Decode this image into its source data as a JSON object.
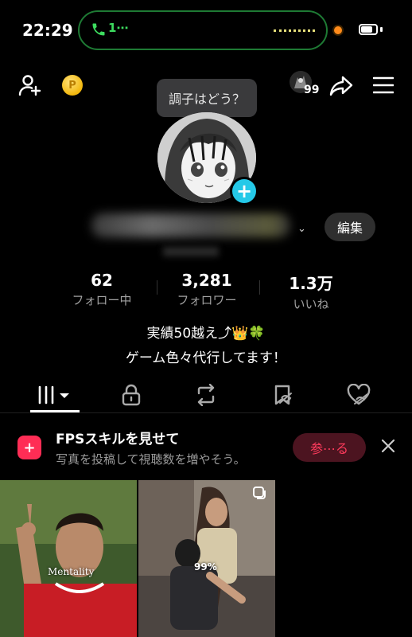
{
  "status_bar": {
    "time": "22:29",
    "call_text": "1⋯"
  },
  "header": {
    "tooltip": "調子はどう？",
    "friend_count": "99"
  },
  "profile": {
    "edit_label": "編集",
    "stats": [
      {
        "value": "62",
        "label": "フォロー中"
      },
      {
        "value": "3,281",
        "label": "フォロワー"
      },
      {
        "value": "1.3万",
        "label": "いいね"
      }
    ],
    "bio_line1": "実績50越え⤴︎👑🍀",
    "bio_line2": "ゲーム色々代行してます！"
  },
  "tabs": [
    "videos-grid-icon",
    "lock-icon",
    "repost-icon",
    "favorites-icon",
    "liked-icon"
  ],
  "promo": {
    "title": "FPSスキルを見せて",
    "subtitle": "写真を投稿して視聴数を増やそう。",
    "button": "参⋯る"
  },
  "videos": [
    {
      "caption": "Mentality"
    },
    {
      "caption": "99%"
    }
  ],
  "colors": {
    "accent": "#ff3b5c",
    "badge": "#25c9e8",
    "call_green": "#3ddc5f"
  }
}
